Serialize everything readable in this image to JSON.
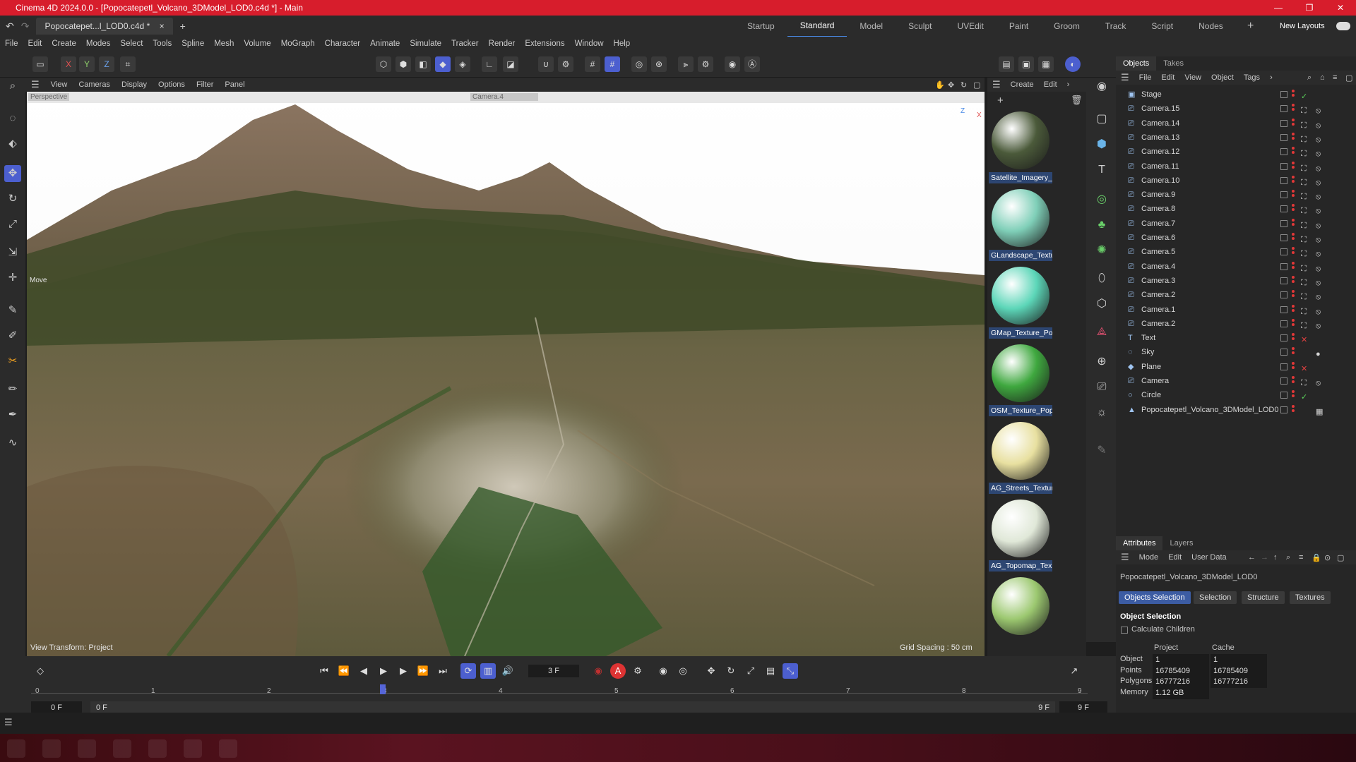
{
  "titlebar": {
    "title": "Cinema 4D 2024.0.0 - [Popocatepetl_Volcano_3DModel_LOD0.c4d *] - Main"
  },
  "tabs": {
    "document": "Popocatepet...l_LOD0.c4d *",
    "close": "×",
    "add": "+",
    "layouts": [
      "Startup",
      "Standard",
      "Model",
      "Sculpt",
      "UVEdit",
      "Paint",
      "Groom",
      "Track",
      "Script",
      "Nodes"
    ],
    "active_layout": "Standard",
    "new_layouts": "New Layouts"
  },
  "menu": [
    "File",
    "Edit",
    "Create",
    "Modes",
    "Select",
    "Tools",
    "Spline",
    "Mesh",
    "Volume",
    "MoGraph",
    "Character",
    "Animate",
    "Simulate",
    "Tracker",
    "Render",
    "Extensions",
    "Window",
    "Help"
  ],
  "toolbar": {
    "axis_x": "X",
    "axis_y": "Y",
    "axis_z": "Z"
  },
  "viewport": {
    "menu": [
      "View",
      "Cameras",
      "Display",
      "Options",
      "Filter",
      "Panel"
    ],
    "perspective_label": "Perspective",
    "camera_label": "Camera.4",
    "tool_label": "Move",
    "view_transform": "View Transform: Project",
    "grid_spacing": "Grid Spacing : 50 cm",
    "axis_z": "Z",
    "axis_x": "X"
  },
  "materials": {
    "menu": [
      "Create",
      "Edit"
    ],
    "items": [
      {
        "name": "Satellite_Imagery_",
        "color": "#4b5a3a"
      },
      {
        "name": "GLandscape_Textu",
        "color": "#7fcfb8"
      },
      {
        "name": "GMap_Texture_Po",
        "color": "#5cd6b8"
      },
      {
        "name": "OSM_Texture_Pop",
        "color": "#3fa83f"
      },
      {
        "name": "AG_Streets_Textur",
        "color": "#e8e0a0"
      },
      {
        "name": "AG_Topomap_Tex",
        "color": "#e0e8d8"
      },
      {
        "name": "",
        "color": "#9cc870"
      }
    ]
  },
  "objects": {
    "tabs": [
      "Objects",
      "Takes"
    ],
    "menu": [
      "File",
      "Edit",
      "View",
      "Object",
      "Tags"
    ],
    "rows": [
      {
        "name": "Stage",
        "type": "stage"
      },
      {
        "name": "Camera.15",
        "type": "camera"
      },
      {
        "name": "Camera.14",
        "type": "camera"
      },
      {
        "name": "Camera.13",
        "type": "camera"
      },
      {
        "name": "Camera.12",
        "type": "camera"
      },
      {
        "name": "Camera.11",
        "type": "camera"
      },
      {
        "name": "Camera.10",
        "type": "camera"
      },
      {
        "name": "Camera.9",
        "type": "camera"
      },
      {
        "name": "Camera.8",
        "type": "camera"
      },
      {
        "name": "Camera.7",
        "type": "camera"
      },
      {
        "name": "Camera.6",
        "type": "camera"
      },
      {
        "name": "Camera.5",
        "type": "camera"
      },
      {
        "name": "Camera.4",
        "type": "camera"
      },
      {
        "name": "Camera.3",
        "type": "camera"
      },
      {
        "name": "Camera.2",
        "type": "camera"
      },
      {
        "name": "Camera.1",
        "type": "camera"
      },
      {
        "name": "Camera.2",
        "type": "camera"
      },
      {
        "name": "Text",
        "type": "text"
      },
      {
        "name": "Sky",
        "type": "sky"
      },
      {
        "name": "Plane",
        "type": "plane"
      },
      {
        "name": "Camera",
        "type": "camera"
      },
      {
        "name": "Circle",
        "type": "circle"
      },
      {
        "name": "Popocatepetl_Volcano_3DModel_LOD0",
        "type": "mesh"
      }
    ]
  },
  "attributes": {
    "tabs": [
      "Attributes",
      "Layers"
    ],
    "menu": [
      "Mode",
      "Edit",
      "User Data"
    ],
    "object_name": "Popocatepetl_Volcano_3DModel_LOD0",
    "buttons": [
      "Objects Selection",
      "Selection",
      "Structure",
      "Textures"
    ],
    "section": "Object Selection",
    "calc_children": "Calculate Children",
    "col_project": "Project",
    "col_cache": "Cache",
    "rows": [
      {
        "label": "Object",
        "project": "1",
        "cache": "1"
      },
      {
        "label": "Points",
        "project": "16785409",
        "cache": "16785409"
      },
      {
        "label": "Polygons",
        "project": "16777216",
        "cache": "16777216"
      },
      {
        "label": "Memory",
        "project": "1.12 GB",
        "cache": ""
      }
    ]
  },
  "timeline": {
    "current_frame": "3 F",
    "start_frame": "0 F",
    "start_frame2": "0 F",
    "end_frame": "9 F",
    "end_frame2": "9 F",
    "ticks": [
      "0",
      "1",
      "2",
      "3",
      "4",
      "5",
      "6",
      "7",
      "8",
      "9"
    ]
  }
}
